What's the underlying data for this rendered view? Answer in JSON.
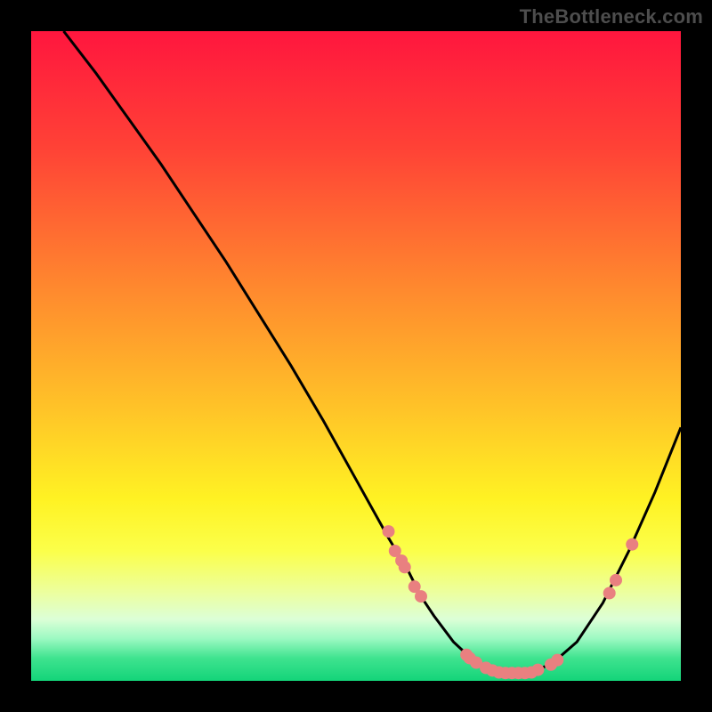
{
  "watermark": "TheBottleneck.com",
  "colors": {
    "curve_stroke": "#000000",
    "point_fill": "#e98080",
    "gradient_stops": [
      {
        "offset": 0.0,
        "color": "#ff163e"
      },
      {
        "offset": 0.18,
        "color": "#ff4236"
      },
      {
        "offset": 0.4,
        "color": "#ff8a2e"
      },
      {
        "offset": 0.58,
        "color": "#ffc328"
      },
      {
        "offset": 0.72,
        "color": "#fff223"
      },
      {
        "offset": 0.8,
        "color": "#fbff4a"
      },
      {
        "offset": 0.865,
        "color": "#ecffa0"
      },
      {
        "offset": 0.905,
        "color": "#dcffd7"
      },
      {
        "offset": 0.935,
        "color": "#9cf9c2"
      },
      {
        "offset": 0.965,
        "color": "#3fe38f"
      },
      {
        "offset": 1.0,
        "color": "#13d479"
      }
    ]
  },
  "chart_data": {
    "type": "line",
    "title": "",
    "xlabel": "",
    "ylabel": "",
    "xlim": [
      0,
      100
    ],
    "ylim": [
      0,
      100
    ],
    "curve": {
      "x": [
        5,
        10,
        15,
        20,
        25,
        30,
        35,
        40,
        45,
        50,
        55,
        58,
        60,
        62,
        65,
        68,
        70,
        73,
        76,
        80,
        84,
        88,
        92,
        96,
        100
      ],
      "y": [
        100,
        93.5,
        86.5,
        79.5,
        72,
        64.5,
        56.5,
        48.5,
        40,
        31,
        22,
        17,
        13,
        10,
        6,
        3.2,
        2,
        1.2,
        1.2,
        2.5,
        6,
        12,
        20,
        29,
        39
      ]
    },
    "points": [
      {
        "x": 55.0,
        "y": 23.0
      },
      {
        "x": 56.0,
        "y": 20.0
      },
      {
        "x": 57.0,
        "y": 18.5
      },
      {
        "x": 57.5,
        "y": 17.5
      },
      {
        "x": 59.0,
        "y": 14.5
      },
      {
        "x": 60.0,
        "y": 13.0
      },
      {
        "x": 67.0,
        "y": 4.0
      },
      {
        "x": 67.5,
        "y": 3.5
      },
      {
        "x": 68.5,
        "y": 2.8
      },
      {
        "x": 70.0,
        "y": 2.0
      },
      {
        "x": 71.0,
        "y": 1.6
      },
      {
        "x": 72.0,
        "y": 1.3
      },
      {
        "x": 73.0,
        "y": 1.2
      },
      {
        "x": 74.0,
        "y": 1.2
      },
      {
        "x": 75.0,
        "y": 1.2
      },
      {
        "x": 76.0,
        "y": 1.2
      },
      {
        "x": 77.0,
        "y": 1.3
      },
      {
        "x": 78.0,
        "y": 1.7
      },
      {
        "x": 80.0,
        "y": 2.5
      },
      {
        "x": 81.0,
        "y": 3.2
      },
      {
        "x": 89.0,
        "y": 13.5
      },
      {
        "x": 90.0,
        "y": 15.5
      },
      {
        "x": 92.5,
        "y": 21.0
      }
    ]
  }
}
